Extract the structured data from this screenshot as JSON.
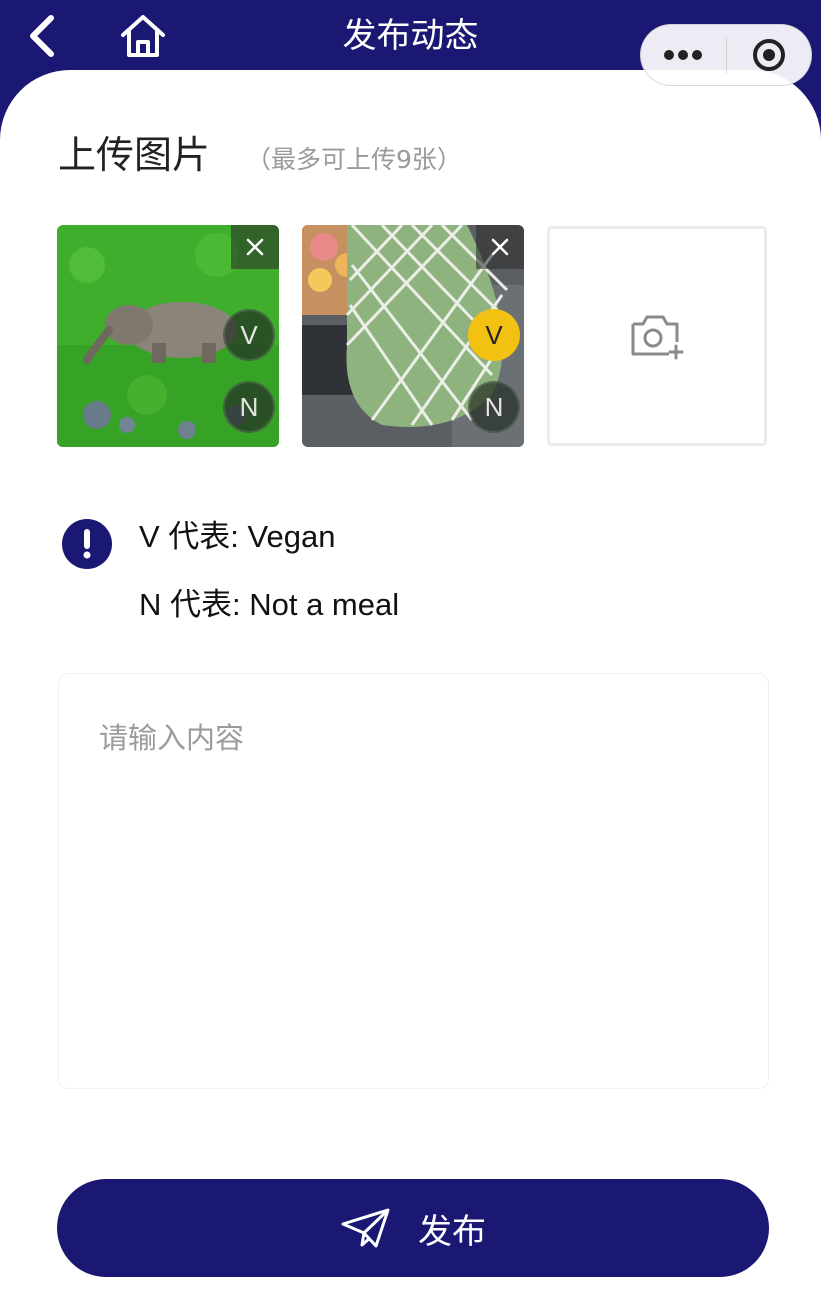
{
  "header": {
    "title": "发布动态",
    "back_icon": "chevron-left-icon",
    "home_icon": "home-icon",
    "more_icon": "more-dots-icon",
    "close_icon": "target-circle-icon"
  },
  "upload": {
    "title": "上传图片",
    "hint": "（最多可上传9张）",
    "images": [
      {
        "description_icon": "elephant-photo",
        "tag_v": "V",
        "tag_n": "N",
        "v_active": false,
        "n_active": false
      },
      {
        "description_icon": "net-bag-photo",
        "tag_v": "V",
        "tag_n": "N",
        "v_active": true,
        "n_active": false
      }
    ],
    "add_icon": "camera-add-icon"
  },
  "legend": {
    "info_icon": "exclamation-icon",
    "v_line": "V 代表: Vegan",
    "n_line": "N 代表: Not a meal"
  },
  "content": {
    "placeholder": "请输入内容",
    "value": ""
  },
  "publish": {
    "label": "发布",
    "icon": "paper-plane-icon"
  },
  "colors": {
    "brand": "#1b1873",
    "tag_active": "#f3c112",
    "hint": "#9a9a9a"
  }
}
